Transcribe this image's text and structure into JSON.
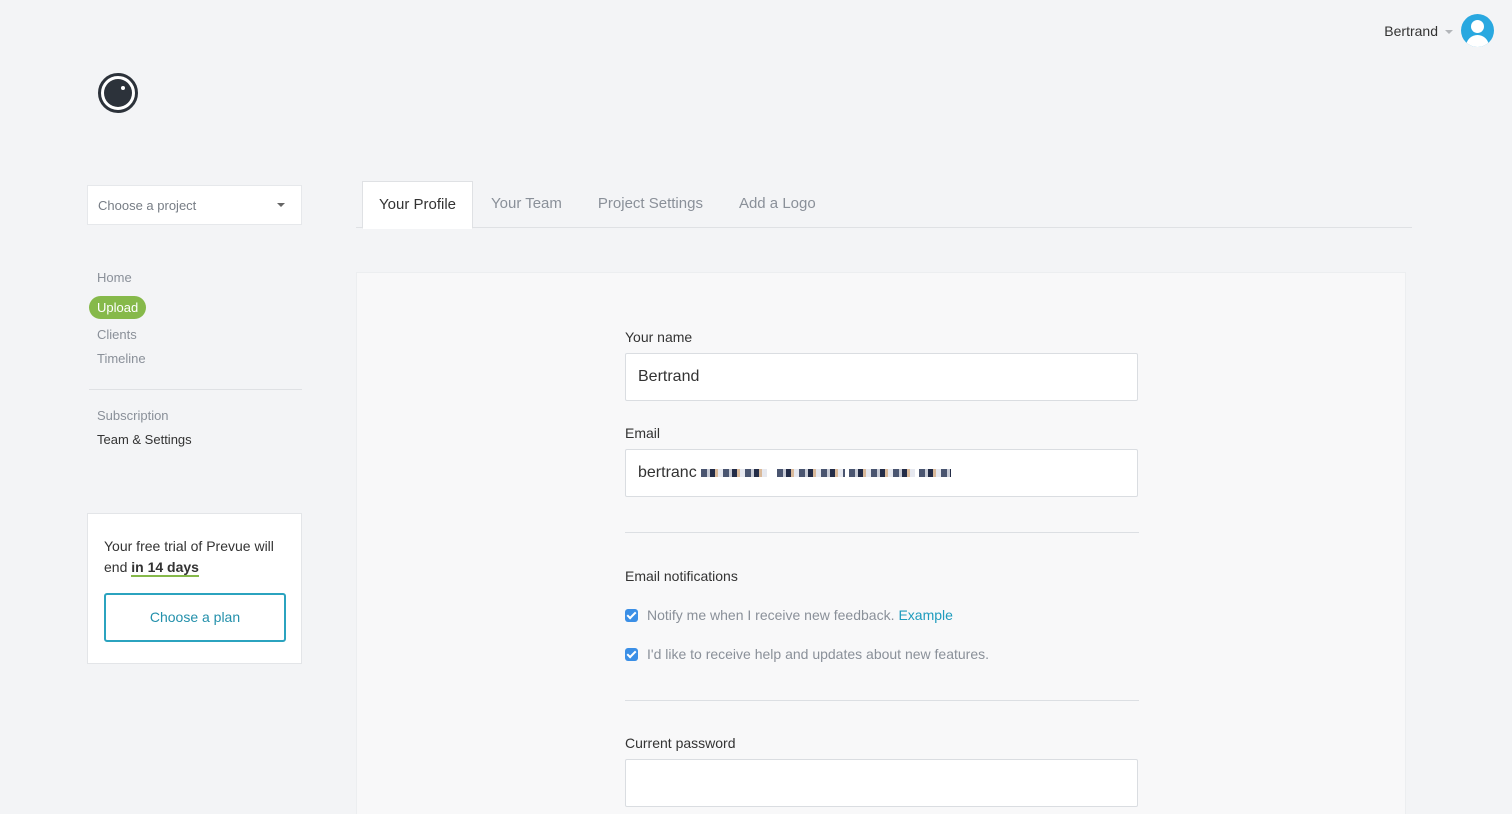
{
  "header": {
    "user_name": "Bertrand"
  },
  "sidebar": {
    "project_select_placeholder": "Choose a project",
    "nav_primary": [
      {
        "label": "Home"
      },
      {
        "label": "Upload"
      },
      {
        "label": "Clients"
      },
      {
        "label": "Timeline"
      }
    ],
    "nav_secondary": [
      {
        "label": "Subscription"
      },
      {
        "label": "Team & Settings"
      }
    ],
    "trial": {
      "text_before": "Your free trial of Prevue will end ",
      "days_text": "in 14 days",
      "button_label": "Choose a plan"
    }
  },
  "tabs": [
    {
      "label": "Your Profile"
    },
    {
      "label": "Your Team"
    },
    {
      "label": "Project Settings"
    },
    {
      "label": "Add a Logo"
    }
  ],
  "form": {
    "name_label": "Your name",
    "name_value": "Bertrand",
    "email_label": "Email",
    "email_value_visible": "bertranc",
    "notifications_title": "Email notifications",
    "notify_feedback_label": "Notify me when I receive new feedback.",
    "notify_feedback_link": "Example",
    "notify_updates_label": "I'd like to receive help and updates about new features.",
    "current_password_label": "Current password",
    "current_password_value": ""
  },
  "colors": {
    "accent_green": "#86b94a",
    "accent_teal": "#2ba3bf",
    "avatar_blue": "#29a8e0",
    "checkbox_blue": "#3b8fe6"
  }
}
